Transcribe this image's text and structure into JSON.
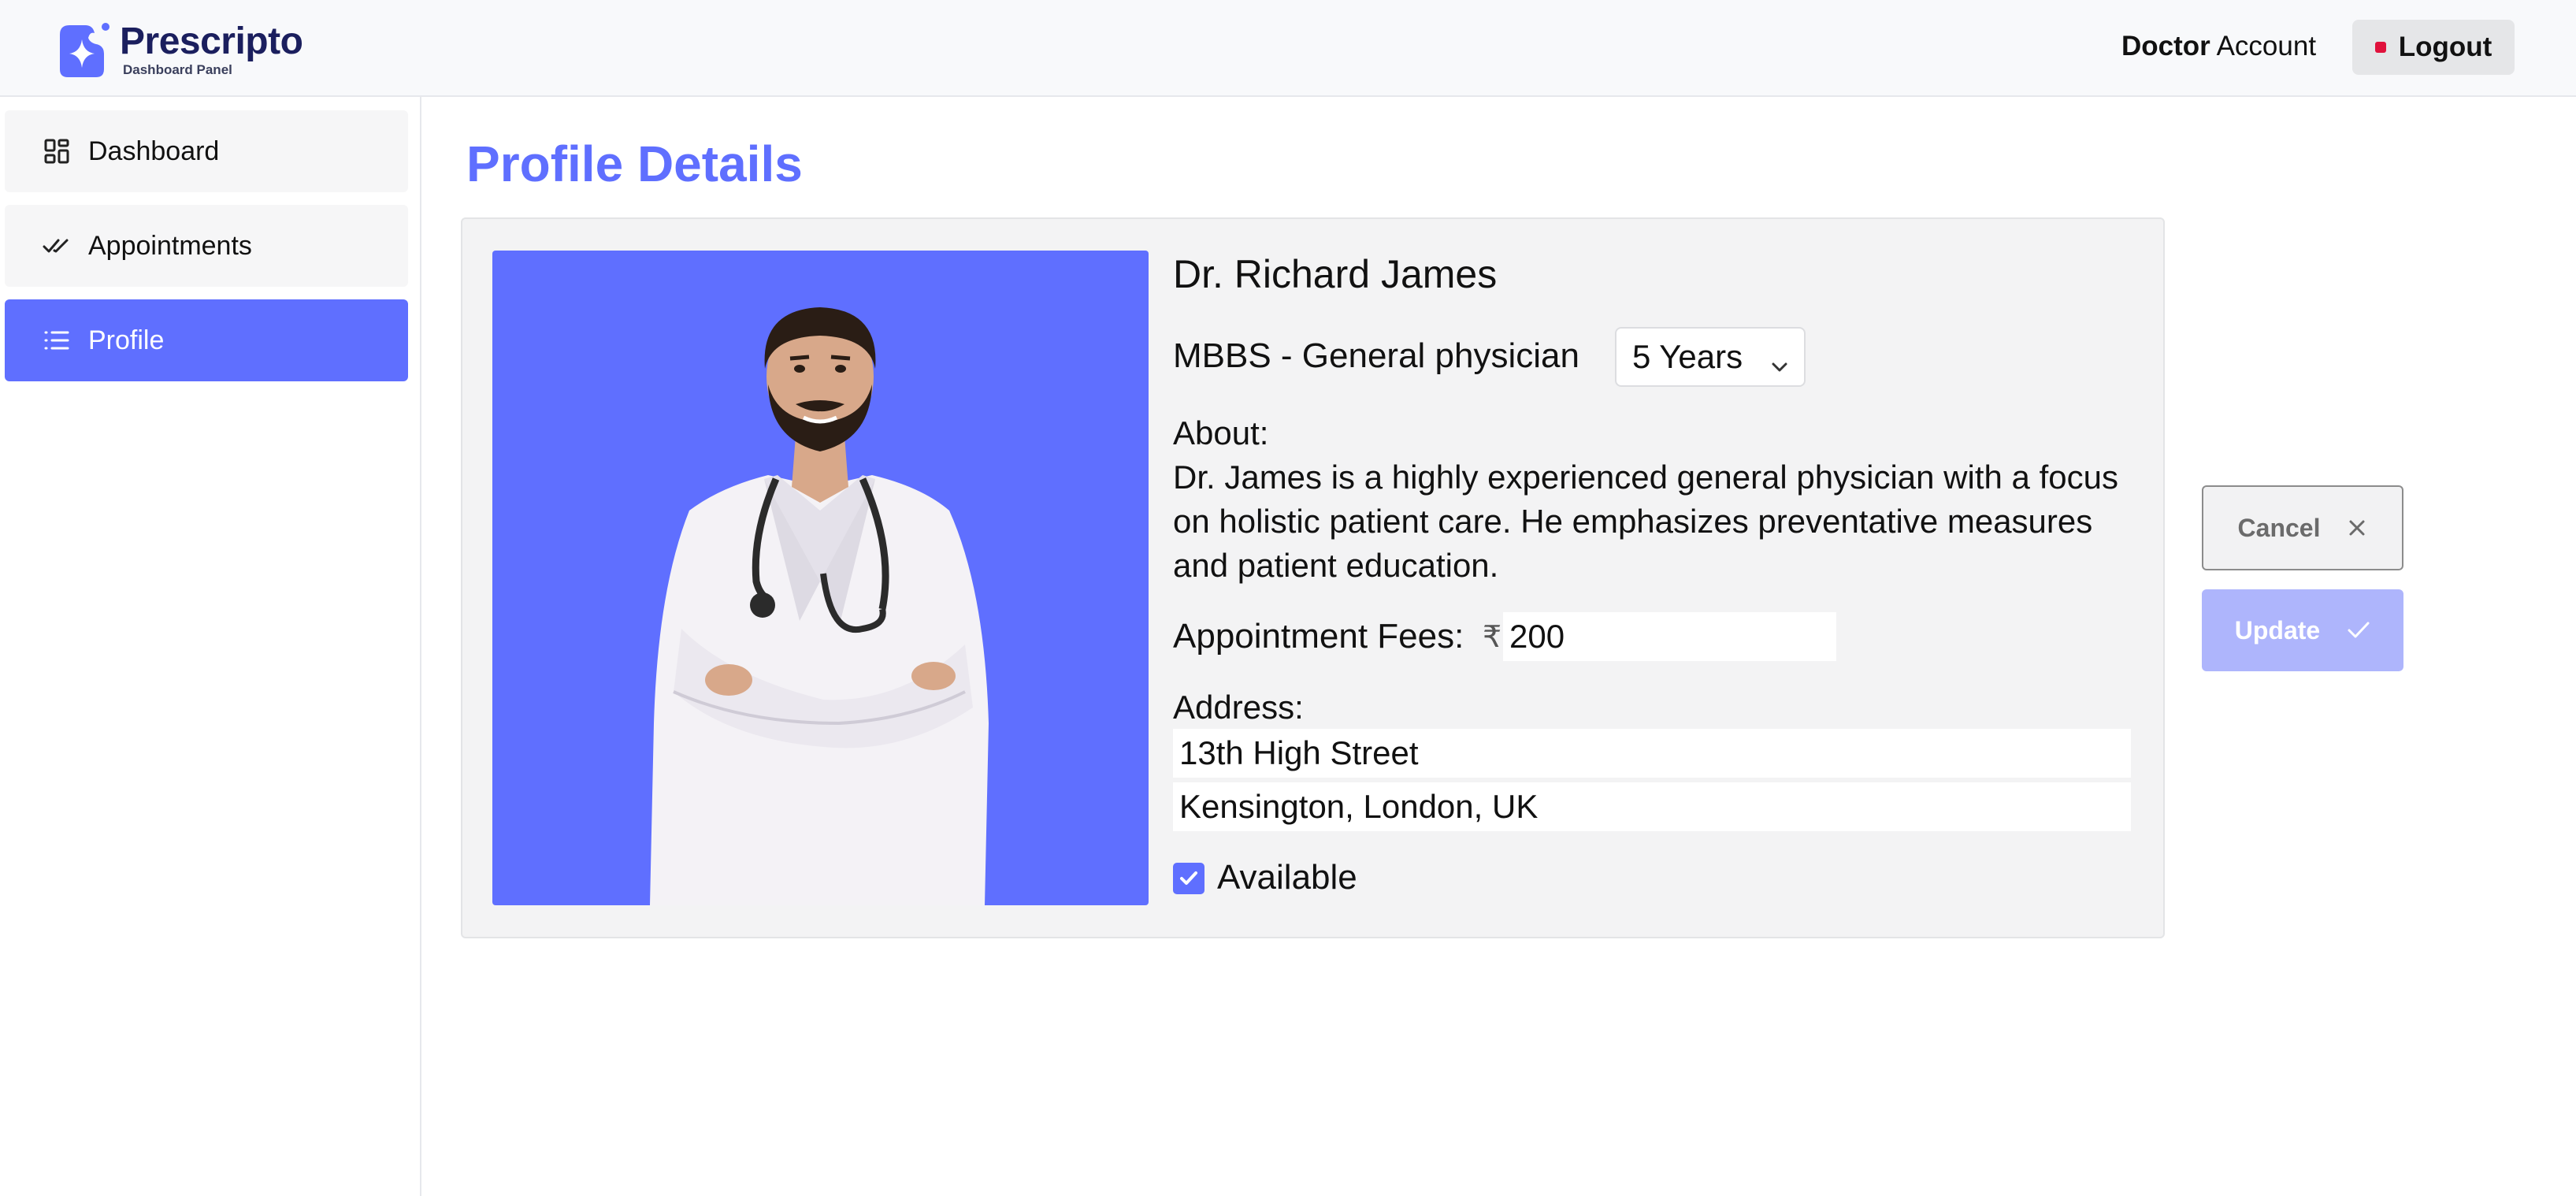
{
  "header": {
    "logo_title": "Prescripto",
    "logo_subtitle": "Dashboard Panel",
    "account_role": "Doctor",
    "account_suffix": " Account",
    "logout_label": "Logout"
  },
  "sidebar": {
    "items": [
      {
        "label": "Dashboard",
        "icon": "grid-icon",
        "active": false
      },
      {
        "label": "Appointments",
        "icon": "double-check-icon",
        "active": false
      },
      {
        "label": "Profile",
        "icon": "list-icon",
        "active": true
      }
    ]
  },
  "page": {
    "title": "Profile Details"
  },
  "profile": {
    "name": "Dr. Richard James",
    "degree": "MBBS - General physician",
    "experience_selected": "5 Years",
    "about_label": "About:",
    "about_text": "Dr. James is a highly experienced general physician with a focus on holistic patient care. He emphasizes preventative measures and patient education.",
    "fees_label": "Appointment Fees:",
    "fees_currency": "₹",
    "fees_value": "200",
    "address_label": "Address:",
    "address_line1": "13th High Street",
    "address_line2": "Kensington, London, UK",
    "available_label": "Available",
    "available": true
  },
  "actions": {
    "cancel_label": "Cancel",
    "update_label": "Update"
  },
  "colors": {
    "accent": "#5f6fff",
    "accent_light": "#aeb5fc",
    "logout_dot": "#e0123c",
    "logo_text": "#1b1f5e"
  }
}
